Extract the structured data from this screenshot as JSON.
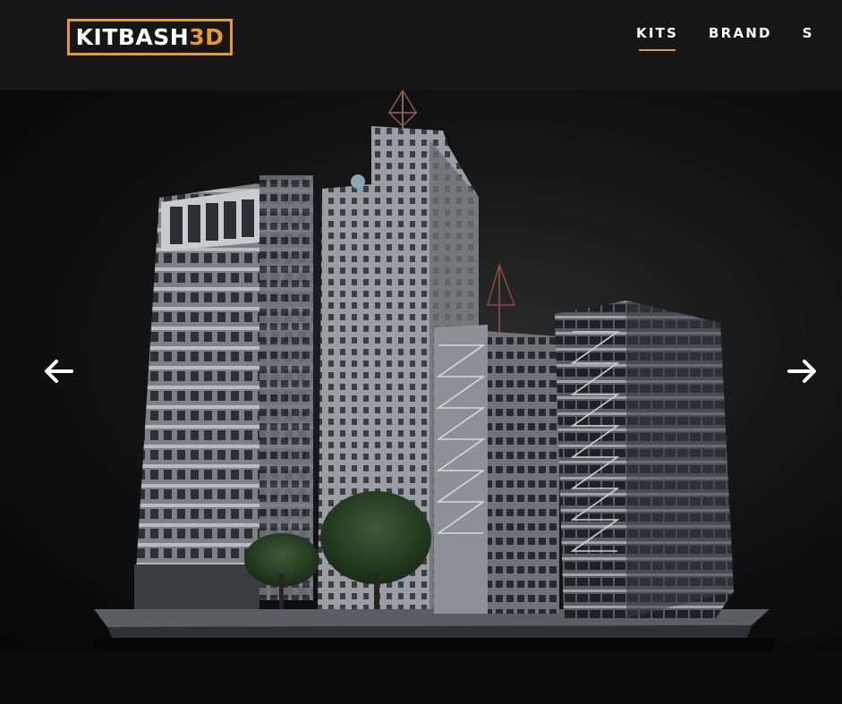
{
  "header": {
    "logo": {
      "text_main": "KITBASH",
      "text_accent": "3D"
    },
    "nav": [
      {
        "label": "KITS",
        "active": true
      },
      {
        "label": "BRAND",
        "active": false
      },
      {
        "label": "S",
        "active": false
      }
    ]
  },
  "hero": {
    "image_subject": "kitbash city buildings render",
    "prev_icon": "arrow-left-icon",
    "next_icon": "arrow-right-icon"
  },
  "colors": {
    "accent": "#e49b2f",
    "header_bg": "#161616",
    "page_bg": "#0a0a0a"
  }
}
